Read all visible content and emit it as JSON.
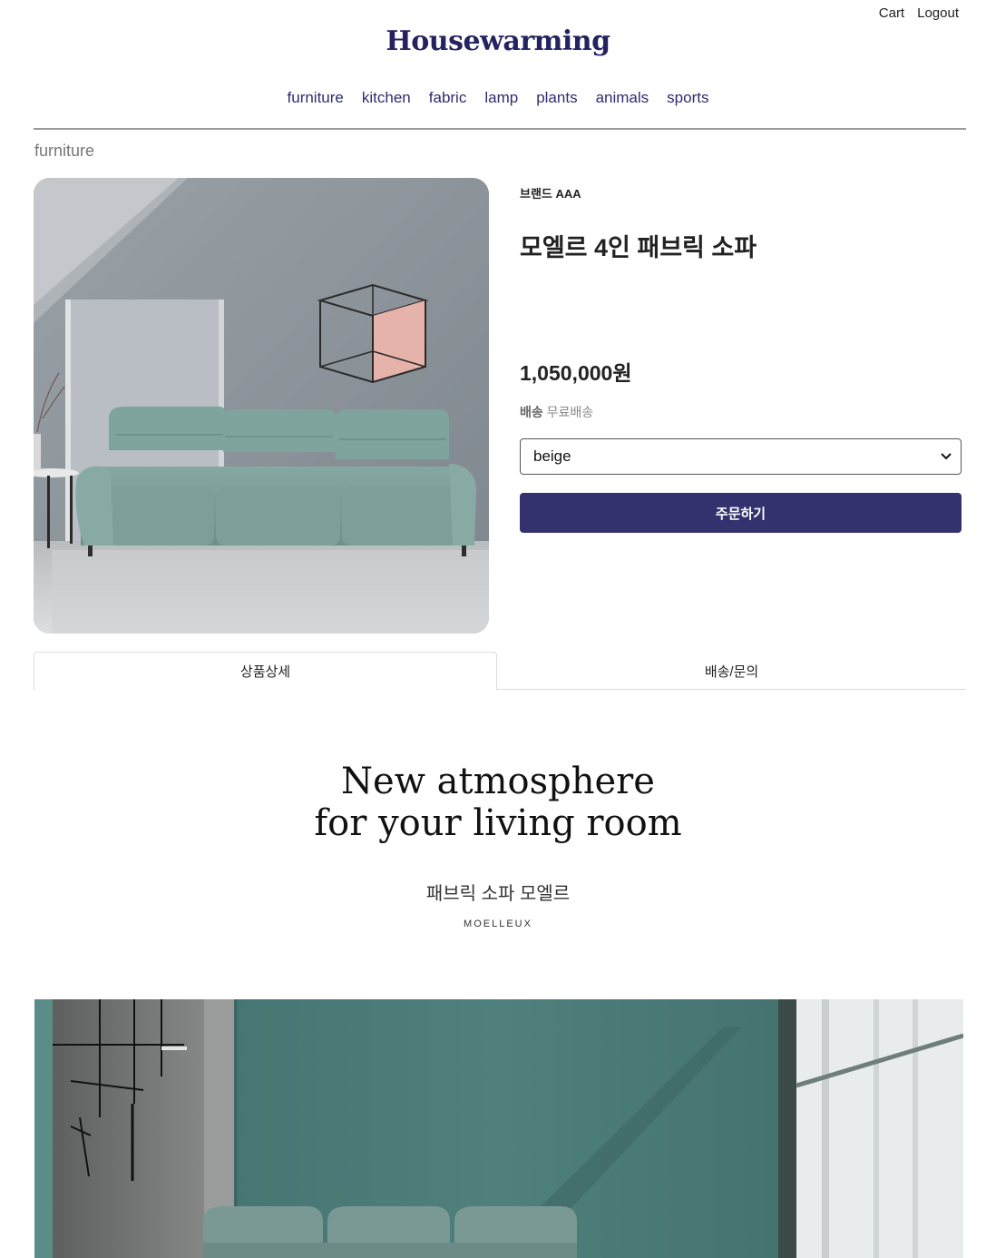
{
  "topbar": {
    "cart": "Cart",
    "logout": "Logout"
  },
  "logo": "Housewarming",
  "nav": [
    "furniture",
    "kitchen",
    "fabric",
    "lamp",
    "plants",
    "animals",
    "sports"
  ],
  "breadcrumb": "furniture",
  "product": {
    "brand": "브랜드 AAA",
    "title": "모엘르 4인 패브릭 소파",
    "price": "1,050,000원",
    "shipping_label": "배송",
    "shipping_value": "무료배송",
    "option_selected": "beige",
    "order_button": "주문하기"
  },
  "tabs": [
    "상품상세",
    "배송/문의"
  ],
  "detail": {
    "title_line1": "New atmosphere",
    "title_line2": "for your living room",
    "subtitle_ko": "패브릭 소파 모엘르",
    "subtitle_en": "MOELLEUX"
  },
  "colors": {
    "brand": "#24225f",
    "nav": "#2f2d6e",
    "button": "#33326e",
    "sofa": "#7fa39d",
    "banner_wall": "#4f7f7b"
  }
}
